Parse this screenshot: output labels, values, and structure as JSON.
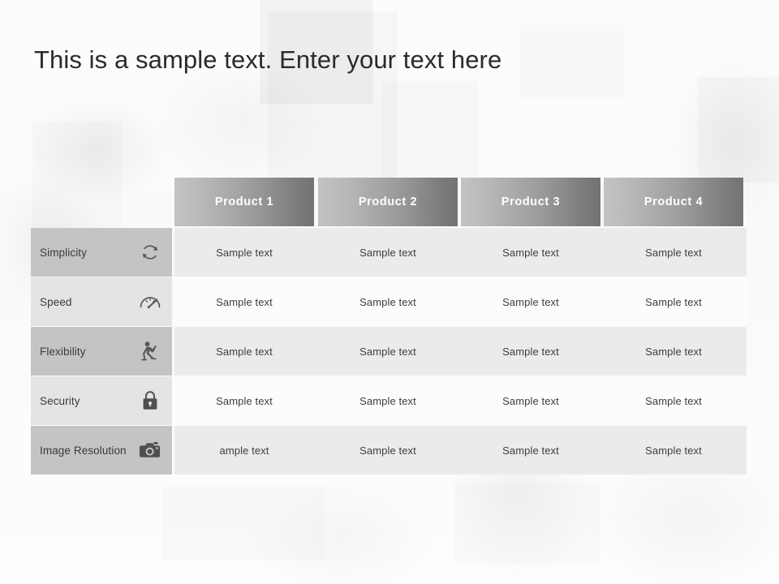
{
  "slide": {
    "title": "This is a sample text. Enter your text here",
    "background": "washed-out office photo"
  },
  "colors": {
    "header_gradient_start": "#c3c3c3",
    "header_gradient_end": "#737373",
    "header_text": "#ffffff",
    "row_label_dark": "#c4c4c4",
    "row_label_light": "#e4e4e4",
    "row_data_dark": "#ebebeb",
    "row_data_light": "#fdfdfd",
    "body_text": "#3d3d3d",
    "title_text": "#2b2b2b"
  },
  "table": {
    "columns": [
      {
        "label": "Product 1"
      },
      {
        "label": "Product 2"
      },
      {
        "label": "Product 3"
      },
      {
        "label": "Product 4"
      }
    ],
    "rows": [
      {
        "label": "Simplicity",
        "icon": "refresh-cycle-icon",
        "shade": "dark",
        "cells": [
          "Sample text",
          "Sample text",
          "Sample text",
          "Sample text"
        ]
      },
      {
        "label": "Speed",
        "icon": "speedometer-icon",
        "shade": "light",
        "cells": [
          "Sample text",
          "Sample text",
          "Sample text",
          "Sample text"
        ]
      },
      {
        "label": "Flexibility",
        "icon": "yoga-pose-icon",
        "shade": "dark",
        "cells": [
          "Sample text",
          "Sample text",
          "Sample text",
          "Sample text"
        ]
      },
      {
        "label": "Security",
        "icon": "padlock-icon",
        "shade": "light",
        "cells": [
          "Sample text",
          "Sample text",
          "Sample text",
          "Sample text"
        ]
      },
      {
        "label": "Image Resolution",
        "icon": "camera-icon",
        "shade": "dark",
        "cells": [
          "ample text",
          "Sample text",
          "Sample text",
          "Sample text"
        ]
      }
    ]
  }
}
